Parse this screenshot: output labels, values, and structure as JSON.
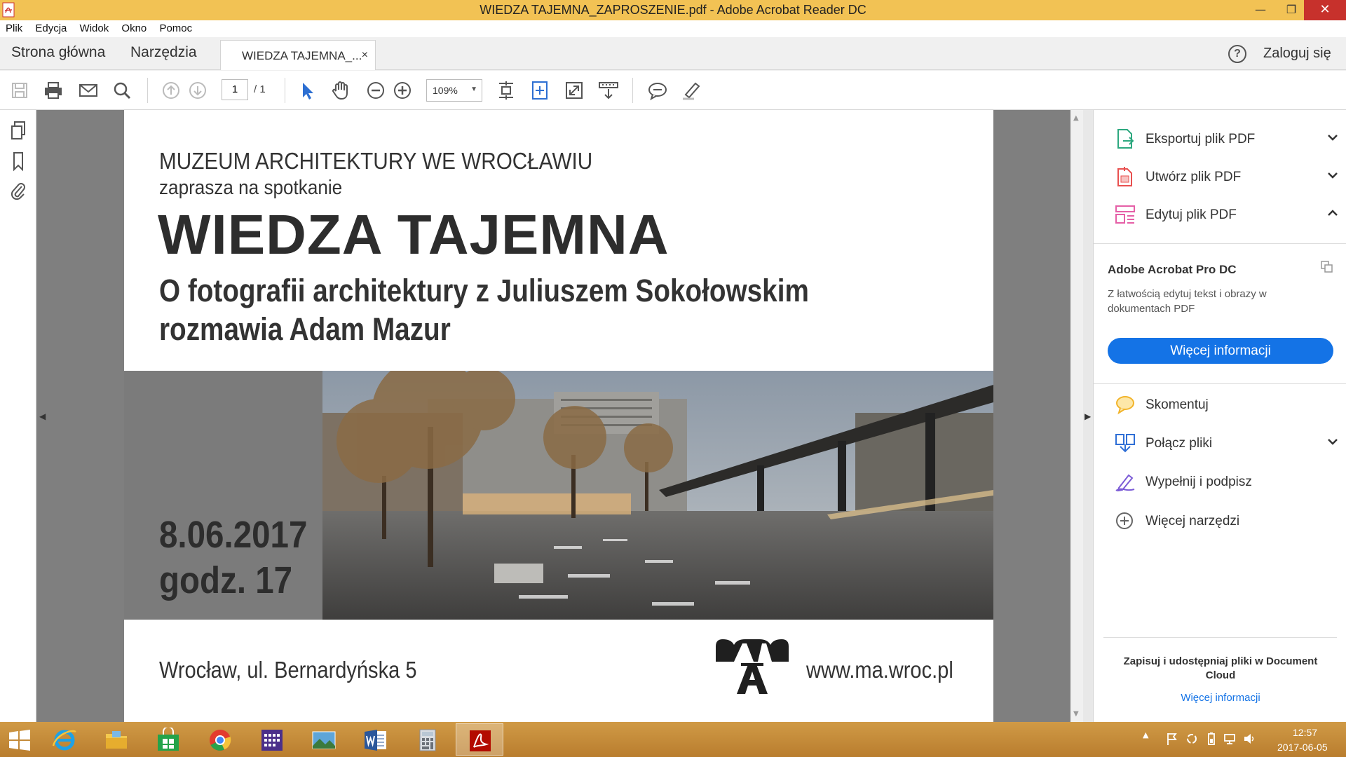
{
  "window": {
    "title": "WIEDZA TAJEMNA_ZAPROSZENIE.pdf - Adobe Acrobat Reader DC",
    "minimize": "—",
    "maximize": "❐",
    "close": "✕"
  },
  "menu": [
    "Plik",
    "Edycja",
    "Widok",
    "Okno",
    "Pomoc"
  ],
  "tabs": {
    "home": "Strona główna",
    "tools": "Narzędzia",
    "document": "WIEDZA TAJEMNA_...",
    "document_close": "×",
    "help": "?",
    "login": "Zaloguj się"
  },
  "toolbar": {
    "page_current": "1",
    "page_total": "/  1",
    "zoom": "109%",
    "zoom_arrow": "▼"
  },
  "document": {
    "museum": "MUZEUM ARCHITEKTURY WE WROCŁAWIU",
    "invite": "zaprasza na spotkanie",
    "title": "WIEDZA TAJEMNA",
    "subtitle_line1": "O fotografii architektury z Juliuszem Sokołowskim",
    "subtitle_line2": "rozmawia Adam Mazur",
    "date": "8.06.2017",
    "time": "godz. 17",
    "address": "Wrocław, ul. Bernardyńska 5",
    "url": "www.ma.wroc.pl",
    "logo_letters": "MA"
  },
  "right_panel": {
    "tools_top": [
      {
        "label": "Eksportuj plik PDF",
        "icon": "export-pdf-icon",
        "color": "#2da87f",
        "chevron": "down"
      },
      {
        "label": "Utwórz plik PDF",
        "icon": "create-pdf-icon",
        "color": "#e8504f",
        "chevron": "down"
      },
      {
        "label": "Edytuj plik PDF",
        "icon": "edit-pdf-icon",
        "color": "#e55fa7",
        "chevron": "up"
      }
    ],
    "pro": {
      "title": "Adobe Acrobat Pro DC",
      "description": "Z łatwością edytuj tekst i obrazy w dokumentach PDF",
      "button": "Więcej informacji"
    },
    "tools_bottom": [
      {
        "label": "Skomentuj",
        "icon": "comment-icon",
        "color": "#f2b42b",
        "chevron": ""
      },
      {
        "label": "Połącz pliki",
        "icon": "combine-files-icon",
        "color": "#2f6fd6",
        "chevron": "down"
      },
      {
        "label": "Wypełnij i podpisz",
        "icon": "fill-sign-icon",
        "color": "#7b5bd6",
        "chevron": ""
      },
      {
        "label": "Więcej narzędzi",
        "icon": "more-tools-icon",
        "color": "#666666",
        "chevron": ""
      }
    ],
    "cloud_text": "Zapisuj i udostępniaj pliki w Document Cloud",
    "cloud_link": "Więcej informacji"
  },
  "taskbar": {
    "apps": [
      "windows-start-icon",
      "internet-explorer-icon",
      "file-explorer-icon",
      "store-icon",
      "chrome-icon",
      "calendar-app-icon",
      "photos-icon",
      "word-icon",
      "calculator-icon",
      "acrobat-reader-icon"
    ],
    "time": "12:57",
    "date": "2017-06-05",
    "tray_expand": "▲"
  },
  "colors": {
    "titlebar": "#f2c254",
    "accent": "#1473e6",
    "close": "#c7312c"
  }
}
